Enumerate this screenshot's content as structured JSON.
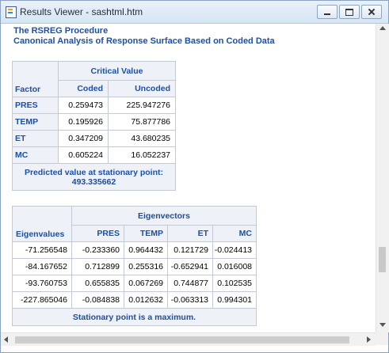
{
  "window": {
    "title": "Results Viewer - sashtml.htm"
  },
  "procedure": "The RSREG Procedure",
  "subtitle": "Canonical Analysis of Response Surface Based on Coded Data",
  "critical": {
    "header": "Critical Value",
    "col_factor": "Factor",
    "col_coded": "Coded",
    "col_uncoded": "Uncoded",
    "rows": [
      {
        "factor": "PRES",
        "coded": "0.259473",
        "uncoded": "225.947276"
      },
      {
        "factor": "TEMP",
        "coded": "0.195926",
        "uncoded": "75.877786"
      },
      {
        "factor": "ET",
        "coded": "0.347209",
        "uncoded": "43.680235"
      },
      {
        "factor": "MC",
        "coded": "0.605224",
        "uncoded": "16.052237"
      }
    ],
    "predicted_label": "Predicted value at stationary point:",
    "predicted_value": "493.335662"
  },
  "eigen": {
    "header": "Eigenvectors",
    "col_eigenvalues": "Eigenvalues",
    "cols": [
      "PRES",
      "TEMP",
      "ET",
      "MC"
    ],
    "rows": [
      {
        "value": "-71.256548",
        "vec": [
          "-0.233360",
          "0.964432",
          "0.121729",
          "-0.024413"
        ]
      },
      {
        "value": "-84.167652",
        "vec": [
          "0.712899",
          "0.255316",
          "-0.652941",
          "0.016008"
        ]
      },
      {
        "value": "-93.760753",
        "vec": [
          "0.655835",
          "0.067269",
          "0.744877",
          "0.102535"
        ]
      },
      {
        "value": "-227.865046",
        "vec": [
          "-0.084838",
          "0.012632",
          "-0.063313",
          "0.994301"
        ]
      }
    ],
    "footer": "Stationary point is a maximum."
  },
  "colors": {
    "header_text": "#1d4fa3",
    "header_bg": "#eef1f7",
    "border": "#c2cbd5"
  }
}
